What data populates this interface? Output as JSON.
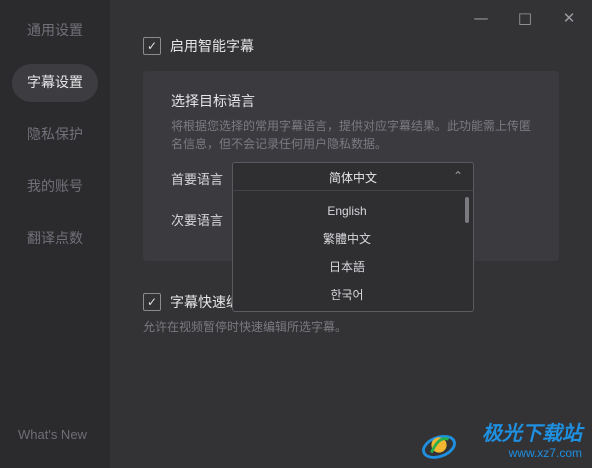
{
  "sidebar": {
    "items": [
      {
        "label": "通用设置",
        "active": false
      },
      {
        "label": "字幕设置",
        "active": true
      },
      {
        "label": "隐私保护",
        "active": false
      },
      {
        "label": "我的账号",
        "active": false
      },
      {
        "label": "翻译点数",
        "active": false
      }
    ],
    "whats_new": "What's New"
  },
  "window": {
    "minimize_icon": "minimize-icon",
    "maximize_icon": "maximize-icon",
    "close_icon": "close-icon"
  },
  "smart_subtitle": {
    "label": "启用智能字幕",
    "checked": true
  },
  "panel": {
    "title": "选择目标语言",
    "description": "将根据您选择的常用字幕语言，提供对应字幕结果。此功能需上传匿名信息，但不会记录任何用户隐私数据。",
    "primary_label": "首要语言",
    "secondary_label": "次要语言",
    "primary_value": "简体中文",
    "options": [
      "English",
      "繁體中文",
      "日本語",
      "한국어"
    ]
  },
  "quick_edit": {
    "label": "字幕快速编辑",
    "checked": true,
    "hint": "允许在视频暂停时快速编辑所选字幕。"
  },
  "watermark": {
    "title": "极光下载站",
    "url": "www.xz7.com"
  },
  "colors": {
    "accent": "#1f8fe0",
    "background": "#333336"
  }
}
